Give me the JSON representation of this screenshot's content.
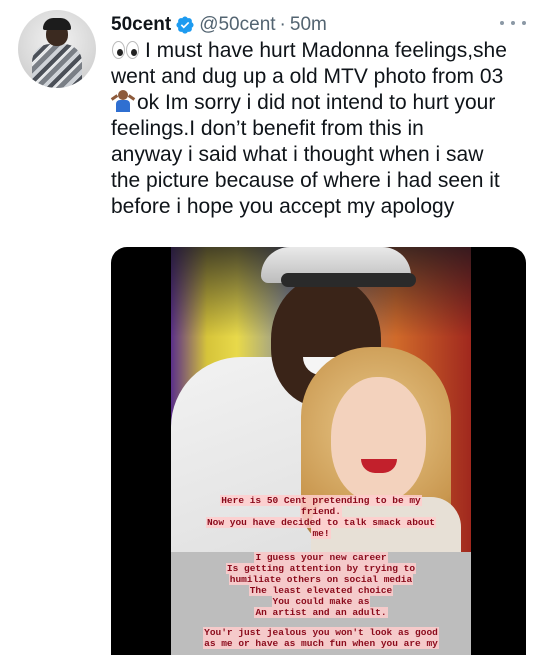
{
  "tweet": {
    "author": {
      "display_name": "50cent",
      "handle": "@50cent",
      "separator": "·",
      "time": "50m",
      "verified": true,
      "verified_color": "#1d9bf0"
    },
    "text_lines": [
      "I must have hurt Madonna feelings,she",
      "went and dug up a old MTV photo from 03",
      "ok Im sorry i did not intend to hurt your",
      "feelings.I don’t benefit from this in",
      "anyway i said what i thought when i saw",
      "the picture because of where i had seen it",
      "before i hope you accept my apology"
    ],
    "emojis": [
      "eyes-emoji",
      "person-shrugging-emoji"
    ],
    "more_icon": "more-horizontal-icon",
    "media": {
      "caption_block_1": [
        "Here is 50 Cent pretending to be my",
        "friend.",
        "Now you have decided to talk smack about",
        "me!"
      ],
      "caption_block_2": [
        "I guess your  new career",
        "Is getting attention by trying to",
        "humiliate others on social media",
        "The least elevated choice",
        "You could make as",
        "An artist and an adult."
      ],
      "caption_block_3": [
        "You'r just jealous you won't look as good",
        "as me or have as much fun when you are my"
      ]
    }
  }
}
